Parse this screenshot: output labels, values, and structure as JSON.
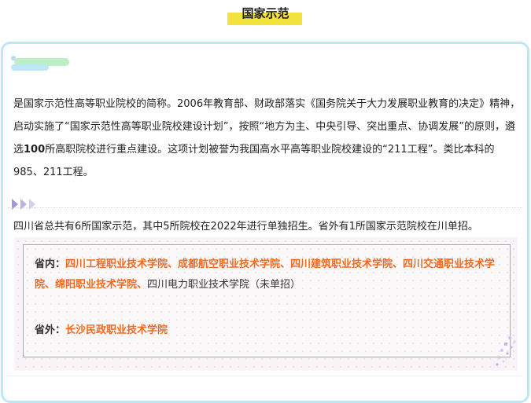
{
  "header": {
    "title": "国家示范"
  },
  "intro": {
    "part1": "是国家示范性高等职业院校的简称。2006年教育部、财政部落实《国务院关于大力发展职业教育的决定》精神，启动实施了“国家示范性高等职业院校建设计划”，按照“地方为主、中央引导、突出重点、协调发展”的原则，遴选",
    "bold_number": "100",
    "part2": "所高职院校进行重点建设。这项计划被誉为我国高水平高等职业院校建设的“211工程”。类比本科的985、211工程。"
  },
  "summary": "四川省总共有6所国家示范，其中5所院校在2022年进行单独招生。省外有1所国家示范院校在川单招。",
  "schools": {
    "inside_label": "省内：",
    "inside_highlight": "四川工程职业技术学院、成都航空职业技术学院、四川建筑职业技术学院、四川交通职业技术学院、绵阳职业技术学院、",
    "inside_plain": "四川电力职业技术学院（未单招）",
    "outside_label": "省外：",
    "outside_highlight": "长沙民政职业技术学院"
  },
  "colors": {
    "title_bar": "#f2e23c",
    "card_border": "#bde7f4",
    "highlight": "#f26a22",
    "arrow": "#b9b4df"
  }
}
